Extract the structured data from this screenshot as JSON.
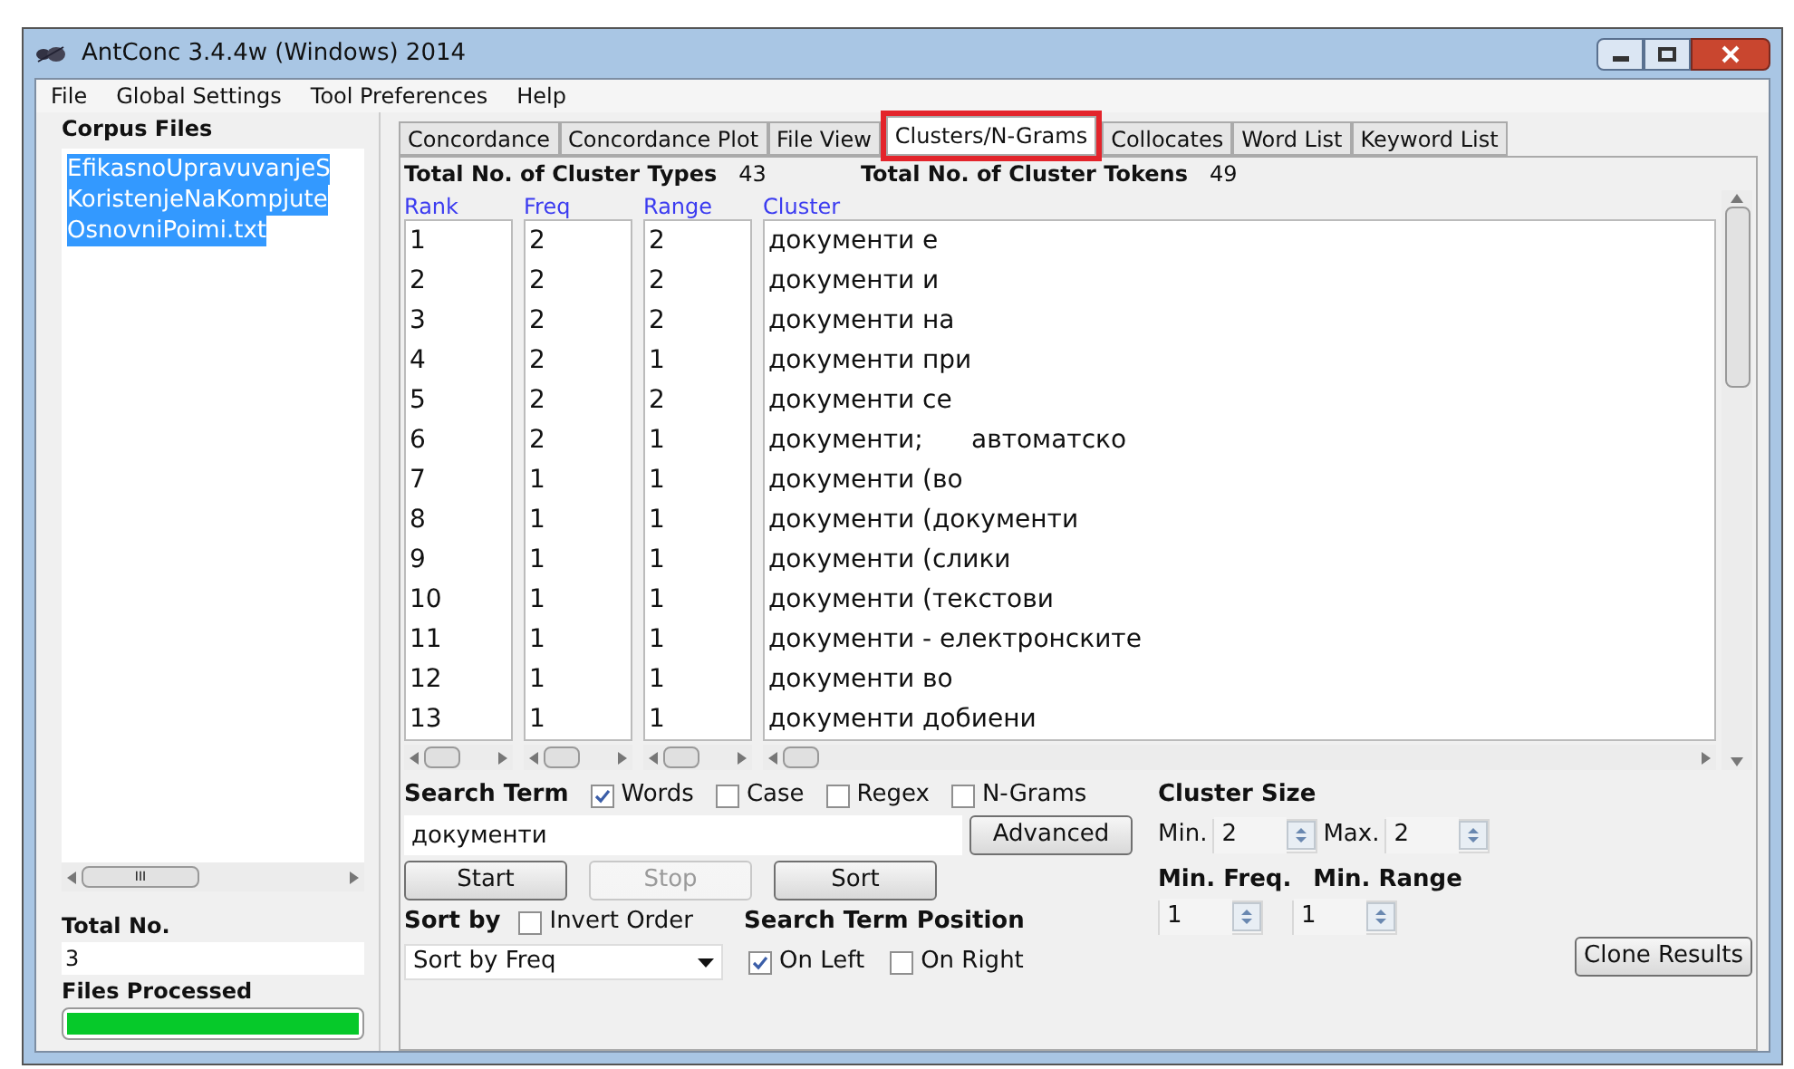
{
  "window": {
    "title": "AntConc 3.4.4w (Windows) 2014"
  },
  "menu": [
    "File",
    "Global Settings",
    "Tool Preferences",
    "Help"
  ],
  "sidebar": {
    "title": "Corpus Files",
    "files": [
      {
        "name": "EfikasnoUpravuvanjeS",
        "selected": true
      },
      {
        "name": "KoristenjeNaKompjute",
        "selected": true
      },
      {
        "name": "OsnovniPoimi.txt",
        "selected": true
      }
    ],
    "scroll_mark": "III",
    "total_label": "Total No.",
    "total_value": "3",
    "processed_label": "Files Processed",
    "progress": {
      "level": 1
    }
  },
  "tabs": [
    {
      "label": "Concordance",
      "selected": false
    },
    {
      "label": "Concordance Plot",
      "selected": false
    },
    {
      "label": "File View",
      "selected": false
    },
    {
      "label": "Clusters/N-Grams",
      "selected": true,
      "highlighted": true
    },
    {
      "label": "Collocates",
      "selected": false
    },
    {
      "label": "Word List",
      "selected": false
    },
    {
      "label": "Keyword List",
      "selected": false
    }
  ],
  "summary": {
    "types_label": "Total No. of Cluster Types",
    "types_value": "43",
    "tokens_label": "Total No. of Cluster Tokens",
    "tokens_value": "49"
  },
  "table": {
    "columns": [
      "Rank",
      "Freq",
      "Range",
      "Cluster"
    ],
    "rows": [
      [
        "1",
        "2",
        "2",
        "документи е"
      ],
      [
        "2",
        "2",
        "2",
        "документи и"
      ],
      [
        "3",
        "2",
        "2",
        "документи на"
      ],
      [
        "4",
        "2",
        "1",
        "документи при"
      ],
      [
        "5",
        "2",
        "2",
        "документи се"
      ],
      [
        "6",
        "2",
        "1",
        "документи;      автоматско"
      ],
      [
        "7",
        "1",
        "1",
        "документи (во"
      ],
      [
        "8",
        "1",
        "1",
        "документи (документи"
      ],
      [
        "9",
        "1",
        "1",
        "документи (слики"
      ],
      [
        "10",
        "1",
        "1",
        "документи (текстови"
      ],
      [
        "11",
        "1",
        "1",
        "документи - електронските"
      ],
      [
        "12",
        "1",
        "1",
        "документи во"
      ],
      [
        "13",
        "1",
        "1",
        "документи добиени"
      ]
    ]
  },
  "search": {
    "label": "Search Term",
    "options": [
      {
        "label": "Words",
        "checked": true
      },
      {
        "label": "Case",
        "checked": false
      },
      {
        "label": "Regex",
        "checked": false
      },
      {
        "label": "N-Grams",
        "checked": false
      }
    ],
    "value": "документи",
    "advanced": "Advanced"
  },
  "buttons": [
    {
      "label": "Start",
      "disabled": false
    },
    {
      "label": "Stop",
      "disabled": true
    },
    {
      "label": "Sort",
      "disabled": false
    }
  ],
  "sort": {
    "label": "Sort by",
    "invert": {
      "label": "Invert Order",
      "checked": false
    },
    "value": "Sort by Freq"
  },
  "position": {
    "label": "Search Term Position",
    "options": [
      {
        "label": "On Left",
        "checked": true
      },
      {
        "label": "On Right",
        "checked": false
      }
    ]
  },
  "cluster_size": {
    "label": "Cluster Size",
    "min_label": "Min.",
    "min": "2",
    "max_label": "Max.",
    "max": "2"
  },
  "min_freq": {
    "label": "Min. Freq.",
    "value": "1"
  },
  "min_range": {
    "label": "Min. Range",
    "value": "1"
  },
  "clone": "Clone Results"
}
